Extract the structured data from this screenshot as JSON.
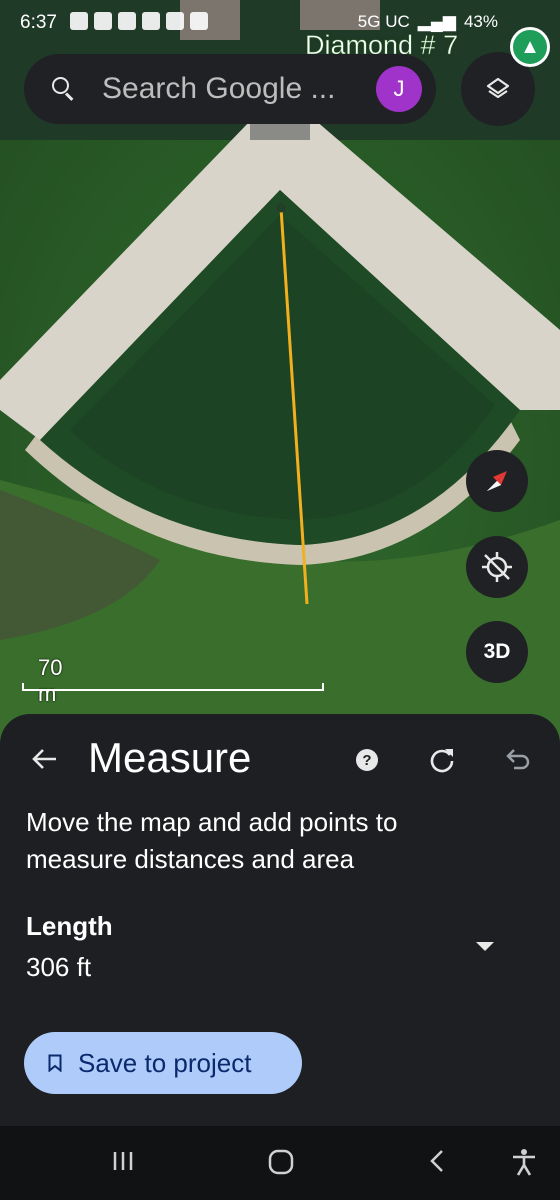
{
  "status_bar": {
    "time": "6:37",
    "network": "5G UC",
    "battery": "43%"
  },
  "map": {
    "place_label": "Diamond # 7",
    "scale_label": "70 m",
    "btn_3d": "3D"
  },
  "search": {
    "placeholder": "Search Google ...",
    "avatar_letter": "J"
  },
  "sheet": {
    "title": "Measure",
    "help_label": "?",
    "description": "Move the map and add points to measure distances and area",
    "length_label": "Length",
    "length_value": "306 ft",
    "save_label": "Save to project"
  },
  "colors": {
    "measure_line": "#f2b01e",
    "avatar": "#a033c9",
    "save_button": "#aecbfa",
    "place_pin": "#1e9e58"
  },
  "icons": [
    "search-icon",
    "layers-icon",
    "compass-icon",
    "location-disabled-icon",
    "back-arrow-icon",
    "help-icon",
    "reset-icon",
    "undo-icon",
    "dropdown-icon",
    "bookmark-icon",
    "recents-icon",
    "home-icon",
    "back-icon",
    "accessibility-icon"
  ]
}
